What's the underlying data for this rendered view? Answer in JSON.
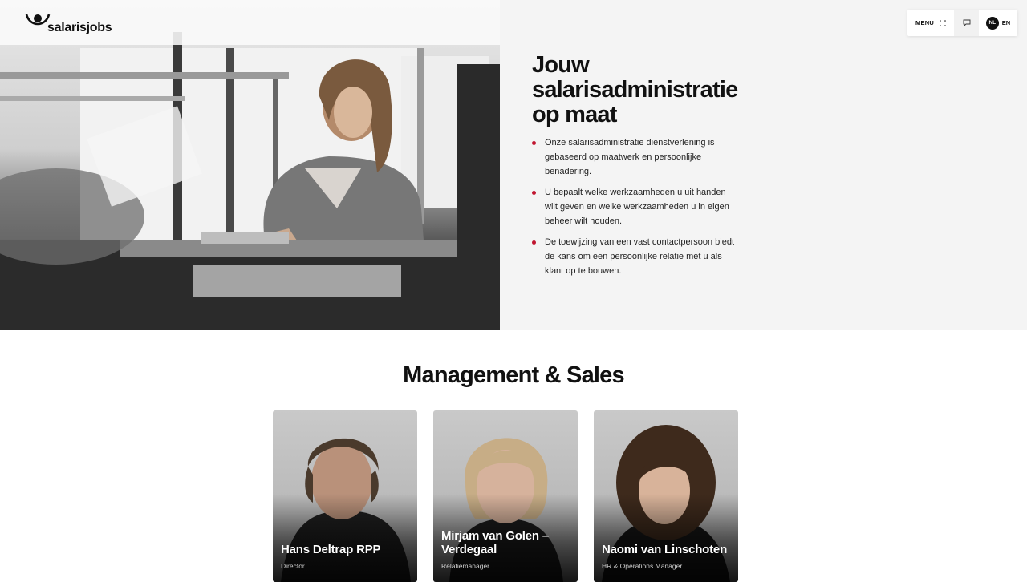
{
  "brand": {
    "name": "salarisjobs"
  },
  "nav": {
    "menu_label": "MENU",
    "lang_active": "NL",
    "lang_other": "EN"
  },
  "hero": {
    "title_lines": [
      "Jouw",
      "salarisadministratie",
      "op maat"
    ],
    "bullets": [
      "Onze salarisadministratie dienstverlening is gebaseerd op maatwerk en persoonlijke benadering.",
      "U bepaalt welke werkzaamheden u uit handen wilt geven en welke werkzaamheden u in eigen beheer wilt houden.",
      "De toewijzing van een vast contactpersoon biedt de kans om een persoonlijke relatie met u als klant op te bouwen."
    ]
  },
  "team": {
    "title": "Management & Sales",
    "members": [
      {
        "name": "Hans Deltrap RPP",
        "role": "Director"
      },
      {
        "name": "Mirjam van Golen – Verdegaal",
        "role": "Relatiemanager"
      },
      {
        "name": "Naomi van Linschoten",
        "role": "HR & Operations Manager"
      }
    ]
  },
  "colors": {
    "accent": "#c0152f",
    "hero_bg": "#f4f4f4",
    "text": "#111111"
  },
  "icons": {
    "menu": "grid-dots-icon",
    "chat": "chat-bubble-icon",
    "logo": "person-arc-logo"
  }
}
